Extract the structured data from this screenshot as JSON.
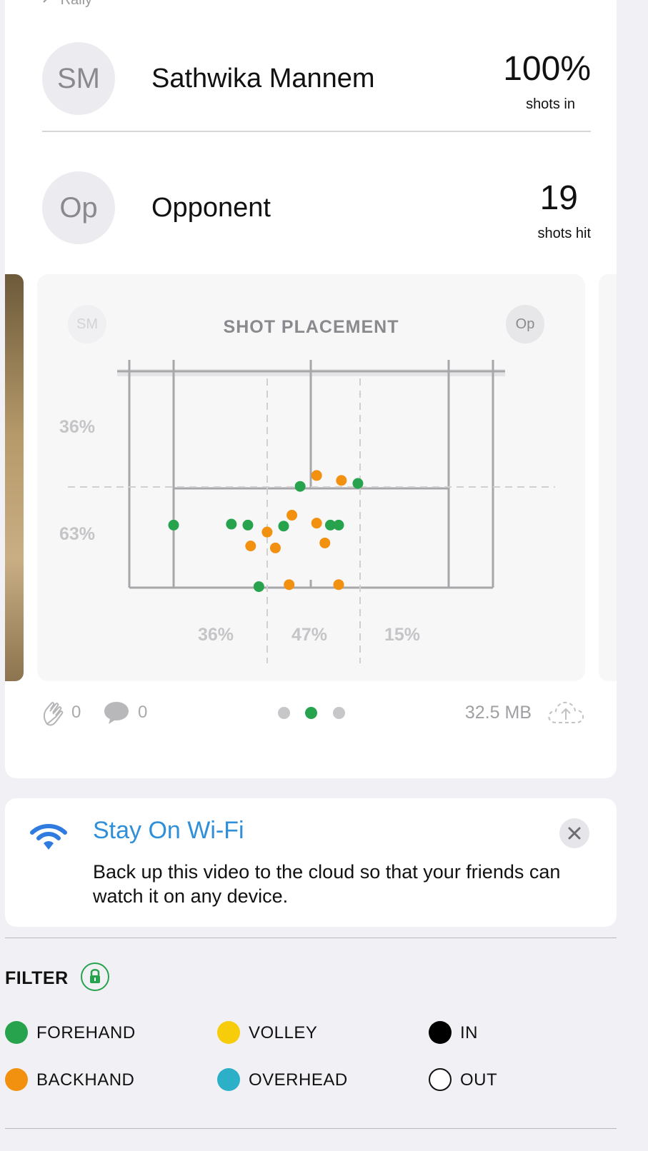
{
  "header": {
    "rally_label": "Rally"
  },
  "players": [
    {
      "initials": "SM",
      "name": "Sathwika Mannem",
      "stat_value": "100%",
      "stat_label": "shots in"
    },
    {
      "initials": "Op",
      "name": "Opponent",
      "stat_value": "19",
      "stat_label": "shots hit"
    }
  ],
  "chart": {
    "title": "SHOT PLACEMENT",
    "left_chip": "SM",
    "right_chip": "Op",
    "depth_pct": {
      "deep": "36%",
      "short": "63%"
    },
    "lateral_pct": {
      "left": "36%",
      "center": "47%",
      "right": "15%"
    }
  },
  "chart_data": {
    "type": "scatter",
    "title": "SHOT PLACEMENT",
    "xlabel": "",
    "ylabel": "",
    "series": [
      {
        "name": "FOREHAND",
        "color": "#27a34e",
        "points": [
          [
            0.46,
            0.02
          ],
          [
            0.67,
            0.05
          ],
          [
            0.0,
            -0.37
          ],
          [
            0.27,
            -0.37
          ],
          [
            0.21,
            -0.36
          ],
          [
            0.4,
            -0.38
          ],
          [
            0.57,
            -0.37
          ],
          [
            0.6,
            -0.37
          ],
          [
            0.31,
            -0.99
          ]
        ]
      },
      {
        "name": "BACKHAND",
        "color": "#f2900f",
        "points": [
          [
            0.34,
            -0.44
          ],
          [
            0.52,
            -0.35
          ],
          [
            0.43,
            -0.27
          ],
          [
            0.52,
            0.13
          ],
          [
            0.61,
            0.08
          ],
          [
            0.55,
            -0.55
          ],
          [
            0.28,
            -0.58
          ],
          [
            0.37,
            -0.6
          ],
          [
            0.42,
            -0.97
          ],
          [
            0.6,
            -0.97
          ]
        ]
      }
    ]
  },
  "footer": {
    "claps": "0",
    "comments": "0",
    "file_size": "32.5 MB",
    "page_dots": 3,
    "active_dot": 2
  },
  "wifi_card": {
    "title": "Stay On Wi-Fi",
    "body": "Back up this video to the cloud so that your friends can watch it on any device."
  },
  "filter": {
    "title": "FILTER",
    "items": [
      {
        "label": "FOREHAND",
        "color": "#27a34e"
      },
      {
        "label": "VOLLEY",
        "color": "#f7cc0a"
      },
      {
        "label": "IN",
        "color": "#000000"
      },
      {
        "label": "BACKHAND",
        "color": "#f2900f"
      },
      {
        "label": "OVERHEAD",
        "color": "#2bb0c8"
      },
      {
        "label": "OUT",
        "color": "#ffffff"
      }
    ]
  }
}
